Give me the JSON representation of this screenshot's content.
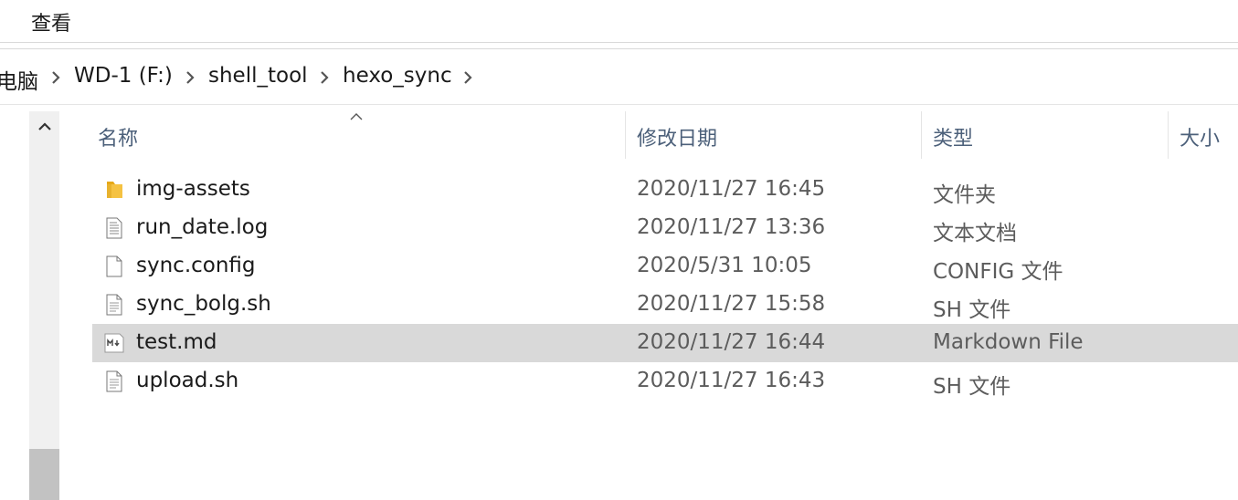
{
  "ribbon": {
    "view_tab": "查看"
  },
  "breadcrumb": {
    "items": [
      "电脑",
      "WD-1 (F:)",
      "shell_tool",
      "hexo_sync"
    ]
  },
  "columns": {
    "name": "名称",
    "modified": "修改日期",
    "type": "类型",
    "size": "大小"
  },
  "files": [
    {
      "name": "img-assets",
      "modified": "2020/11/27 16:45",
      "type": "文件夹",
      "icon": "folder-icon",
      "selected": false
    },
    {
      "name": "run_date.log",
      "modified": "2020/11/27 13:36",
      "type": "文本文档",
      "icon": "text-document-icon",
      "selected": false
    },
    {
      "name": "sync.config",
      "modified": "2020/5/31 10:05",
      "type": "CONFIG 文件",
      "icon": "blank-file-icon",
      "selected": false
    },
    {
      "name": "sync_bolg.sh",
      "modified": "2020/11/27 15:58",
      "type": "SH 文件",
      "icon": "script-file-icon",
      "selected": false
    },
    {
      "name": "test.md",
      "modified": "2020/11/27 16:44",
      "type": "Markdown File",
      "icon": "markdown-file-icon",
      "selected": true
    },
    {
      "name": "upload.sh",
      "modified": "2020/11/27 16:43",
      "type": "SH 文件",
      "icon": "script-file-icon",
      "selected": false
    }
  ],
  "colors": {
    "selection": "#d9d9d9",
    "header_text": "#4c607a",
    "folder": "#f5c242"
  }
}
